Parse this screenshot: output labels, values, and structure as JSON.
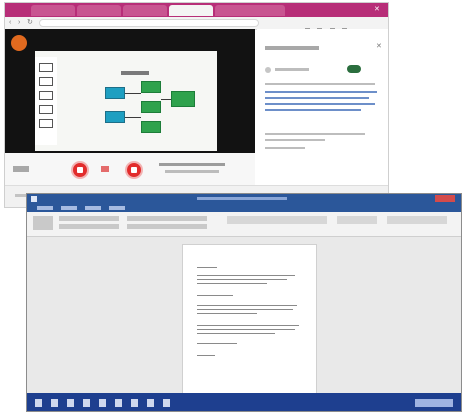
{
  "browser": {
    "tabs": [
      "",
      "",
      "",
      "",
      ""
    ],
    "url": "",
    "video_title": "",
    "side_panel": {
      "heading": "",
      "toggle_label": "",
      "lines": []
    },
    "controls": {
      "left_label": "",
      "center_label": ""
    }
  },
  "word": {
    "title": "",
    "page_text": []
  },
  "colors": {
    "browser_tabstrip": "#b72e78",
    "record_red": "#e22c2c",
    "word_blue": "#2b579a",
    "taskbar_blue": "#1e3f8f",
    "flow_teal": "#1e9fc1",
    "flow_green": "#2fa24d"
  },
  "icons": [
    "record-button-icon",
    "stop-button-icon",
    "word-logo-icon",
    "taskbar-app-icons"
  ]
}
